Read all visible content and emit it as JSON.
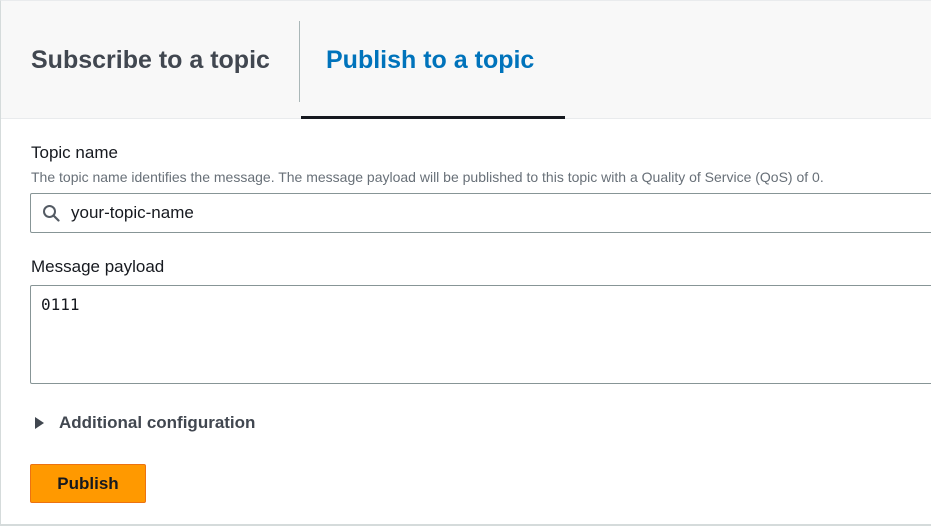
{
  "tabs": {
    "subscribe_label": "Subscribe to a topic",
    "publish_label": "Publish to a topic",
    "active": "publish"
  },
  "topic": {
    "label": "Topic name",
    "description": "The topic name identifies the message. The message payload will be published to this topic with a Quality of Service (QoS) of 0.",
    "value": "your-topic-name",
    "icon": "search-icon"
  },
  "payload": {
    "label": "Message payload",
    "value": "0111"
  },
  "additional_config": {
    "label": "Additional configuration",
    "expanded": false
  },
  "actions": {
    "publish_label": "Publish"
  },
  "colors": {
    "active_tab": "#0073bb",
    "primary_button": "#ff9900"
  }
}
